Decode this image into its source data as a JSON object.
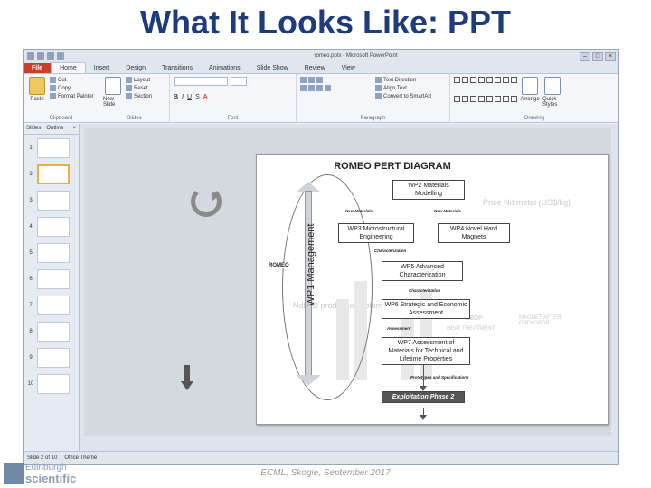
{
  "slide": {
    "title": "What It Looks Like: PPT",
    "footer": "ECML, Skogie, September 2017"
  },
  "logo": {
    "line1": "Edinburgh",
    "line2": "scientific"
  },
  "window": {
    "title": "romeo.pptx - Microsoft PowerPoint"
  },
  "ribbon": {
    "tabs": [
      "File",
      "Home",
      "Insert",
      "Design",
      "Transitions",
      "Animations",
      "Slide Show",
      "Review",
      "View"
    ],
    "active_tab": "Home",
    "clipboard": {
      "label": "Clipboard",
      "paste": "Paste",
      "cut": "Cut",
      "copy": "Copy",
      "format_painter": "Format Painter"
    },
    "slides": {
      "label": "Slides",
      "new_slide": "New Slide",
      "layout": "Layout",
      "reset": "Reset",
      "section": "Section"
    },
    "font": {
      "label": "Font"
    },
    "paragraph": {
      "label": "Paragraph",
      "text_direction": "Text Direction",
      "align_text": "Align Text",
      "convert": "Convert to SmartArt"
    },
    "drawing": {
      "label": "Drawing",
      "arrange": "Arrange",
      "quick_styles": "Quick Styles"
    }
  },
  "thumbnail_pane": {
    "tab_slides": "Slides",
    "tab_outline": "Outline",
    "slides": [
      {
        "num": "1"
      },
      {
        "num": "2",
        "selected": true
      },
      {
        "num": "3"
      },
      {
        "num": "4"
      },
      {
        "num": "5"
      },
      {
        "num": "6"
      },
      {
        "num": "7"
      },
      {
        "num": "8"
      },
      {
        "num": "9"
      },
      {
        "num": "10"
      }
    ]
  },
  "status": {
    "slide_info": "Slide 2 of 10",
    "theme": "Office Theme"
  },
  "diagram": {
    "title": "ROMEO PERT DIAGRAM",
    "wp1_label": "WP1 Management",
    "romeo_label": "ROMEO",
    "boxes": {
      "wp2": "WP2 Materials Modelling",
      "wp3": "WP3 Microstructural Engineering",
      "wp4": "WP4 Novel Hard Magnets",
      "wp5": "WP5 Advanced Characterization",
      "wp6": "WP6 Strategic and Economic Assessment",
      "wp7": "WP7 Assessment of Materials for Technical and Lifetime Properties",
      "exploitation": "Exploitation Phase 2"
    },
    "tags": {
      "new_materials_1": "New Materials",
      "new_materials_2": "New Materials",
      "characterization_1": "Characterization",
      "characterization_2": "Characterization",
      "assessment": "Assessment",
      "prototypes": "Prototypes and Specifications"
    },
    "background_text": {
      "price": "Price Nd metal (US$/kg)",
      "production": "NdFeB production volume",
      "gbdp": "GBDP",
      "heat": "HEAT TREATMENT",
      "magnet_after": "MAGNET AFTER GBD+GBDP"
    }
  }
}
